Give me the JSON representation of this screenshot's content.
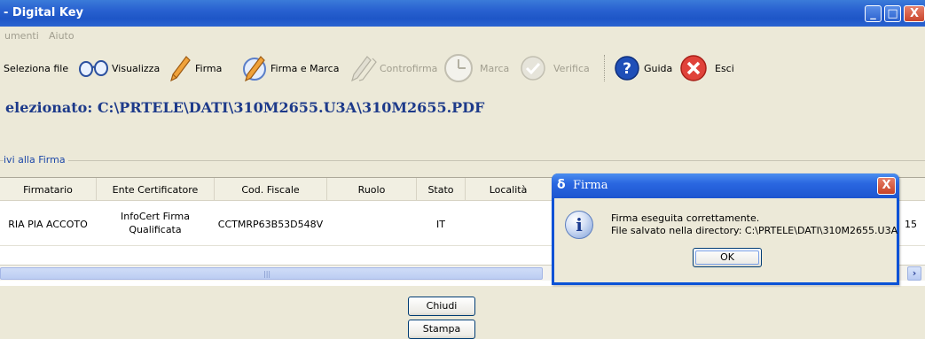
{
  "window": {
    "title": "- Digital Key",
    "minimize": "_",
    "maximize": "□",
    "close": "X"
  },
  "menu": {
    "items": [
      "umenti",
      "Aiuto"
    ]
  },
  "toolbar": {
    "items": [
      {
        "label": "Seleziona file",
        "icon": "folder-icon",
        "enabled": true
      },
      {
        "label": "Visualizza",
        "icon": "glasses-icon",
        "enabled": true
      },
      {
        "label": "Firma",
        "icon": "pen-icon",
        "enabled": true
      },
      {
        "label": "Firma e Marca",
        "icon": "pen-clock-icon",
        "enabled": true
      },
      {
        "label": "Controfirma",
        "icon": "countersign-pen-icon",
        "enabled": false
      },
      {
        "label": "Marca",
        "icon": "clock-icon",
        "enabled": false
      },
      {
        "label": "Verifica",
        "icon": "check-icon",
        "enabled": false
      },
      {
        "label": "Guida",
        "icon": "help-icon",
        "enabled": true
      },
      {
        "label": "Esci",
        "icon": "exit-icon",
        "enabled": true
      }
    ]
  },
  "selected_file": "elezionato: C:\\PRTELE\\DATI\\310M2655.U3A\\310M2655.PDF",
  "group_label": "ivi alla Firma",
  "table": {
    "columns": [
      "Firmatario",
      "Ente Certificatore",
      "Cod. Fiscale",
      "Ruolo",
      "Stato",
      "Località"
    ],
    "rows": [
      {
        "firmatario": "RIA PIA ACCOTO",
        "ente_line1": "InfoCert Firma",
        "ente_line2": "Qualificata",
        "cod_fiscale": "CCTMRP63B53D548V",
        "ruolo": "",
        "stato": "IT",
        "localita": "",
        "overflow": "15"
      }
    ]
  },
  "buttons": {
    "chiudi": "Chiudi",
    "stampa": "Stampa"
  },
  "dialog": {
    "title": "Firma",
    "title_icon": "δ",
    "line1": "Firma eseguita correttamente.",
    "line2": "File salvato nella directory: C:\\PRTELE\\DATI\\310M2655.U3A",
    "ok": "OK",
    "close": "X",
    "info_glyph": "i"
  },
  "colors": {
    "title_bar": "#2a63d1",
    "dialog_border": "#0a52d6",
    "selected_text": "#1d3a8a",
    "group_label": "#1d48a8"
  }
}
